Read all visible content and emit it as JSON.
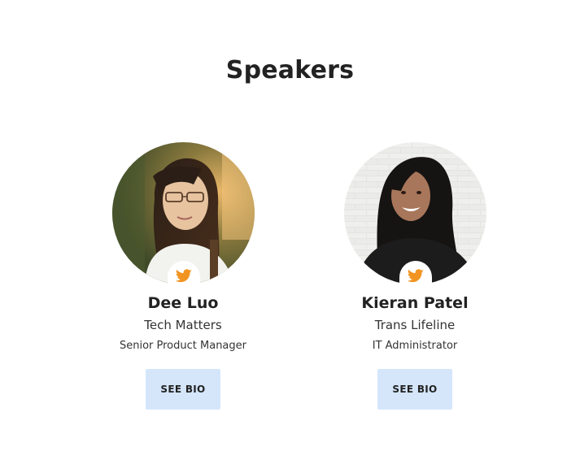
{
  "section": {
    "title": "Speakers"
  },
  "speakers": [
    {
      "name": "Dee Luo",
      "organization": "Tech Matters",
      "role": "Senior Product Manager",
      "bio_button": "SEE BIO",
      "social_icon": "twitter-icon",
      "photo_alt": "Dee Luo"
    },
    {
      "name": "Kieran Patel",
      "organization": "Trans Lifeline",
      "role": "IT Administrator",
      "bio_button": "SEE BIO",
      "social_icon": "twitter-icon",
      "photo_alt": "Kieran Patel"
    }
  ],
  "colors": {
    "twitter_icon": "#f29422",
    "button_bg": "#d5e6fb",
    "text": "#222222"
  }
}
